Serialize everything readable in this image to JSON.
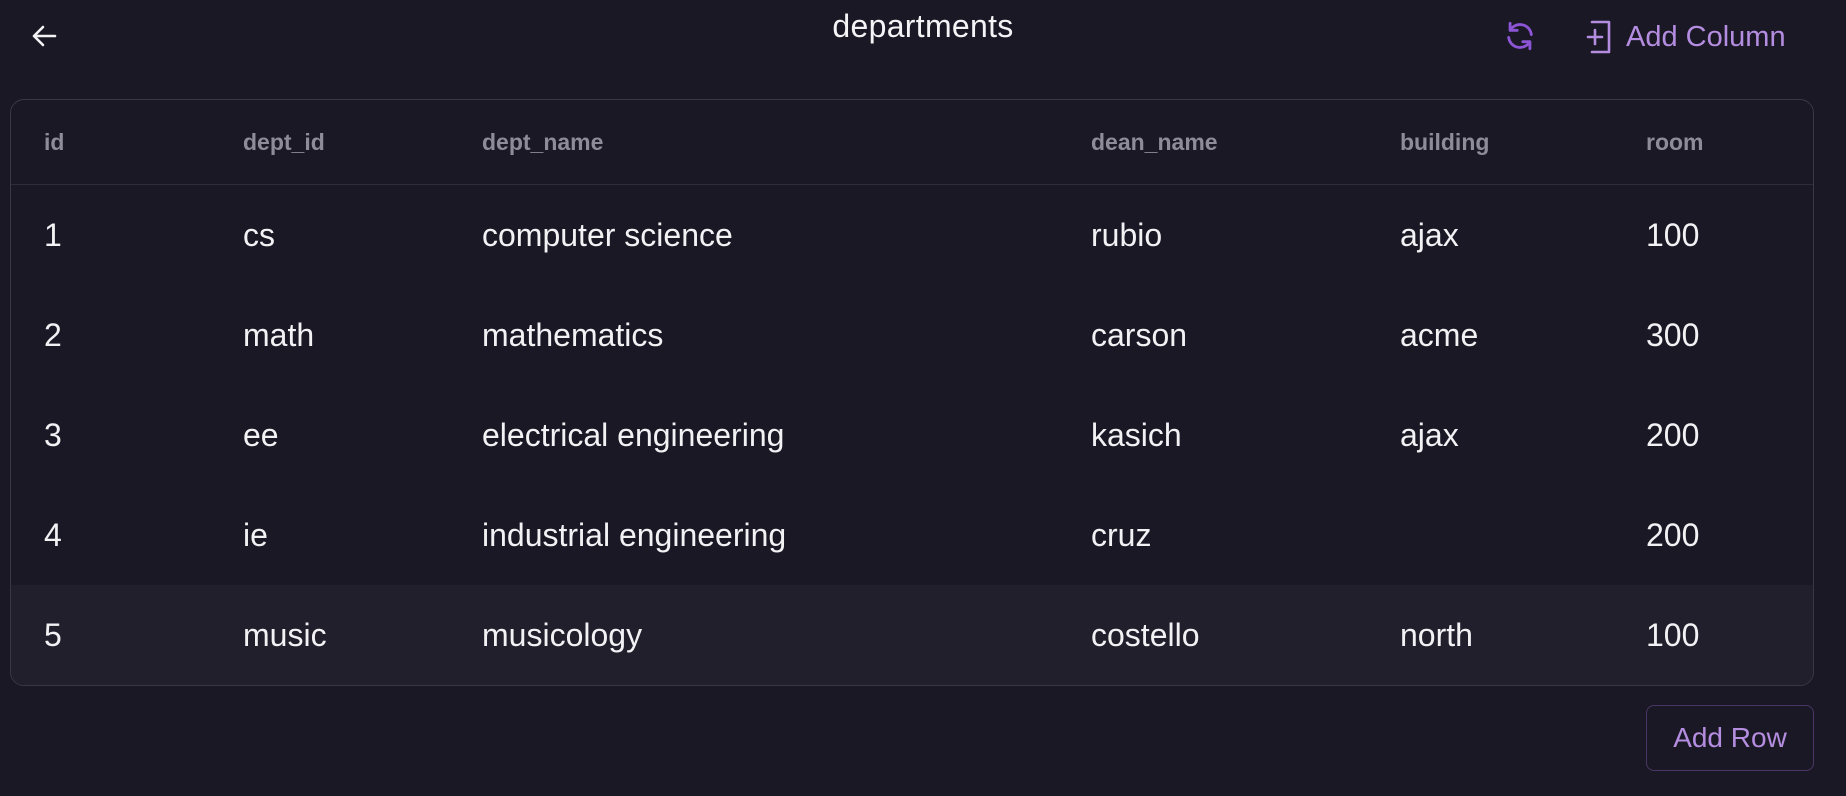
{
  "header": {
    "title": "departments",
    "add_column_label": "Add Column"
  },
  "table": {
    "columns": [
      "id",
      "dept_id",
      "dept_name",
      "dean_name",
      "building",
      "room"
    ],
    "rows": [
      [
        "1",
        "cs",
        "computer science",
        "rubio",
        "ajax",
        "100"
      ],
      [
        "2",
        "math",
        "mathematics",
        "carson",
        "acme",
        "300"
      ],
      [
        "3",
        "ee",
        "electrical engineering",
        "kasich",
        "ajax",
        "200"
      ],
      [
        "4",
        "ie",
        "industrial engineering",
        "cruz",
        "",
        "200"
      ],
      [
        "5",
        "music",
        "musicology",
        "costello",
        "north",
        "100"
      ]
    ],
    "highlighted_row": 4
  },
  "footer": {
    "add_row_label": "Add Row"
  },
  "icons": {
    "back": "arrow-left-icon",
    "refresh": "refresh-icon",
    "add_column": "add-column-icon"
  },
  "colors": {
    "background": "#1a1824",
    "accent": "#b48de0",
    "refresh_accent": "#8b55d6",
    "header_text": "#8f8c99",
    "highlight_row": "#211f2c"
  }
}
